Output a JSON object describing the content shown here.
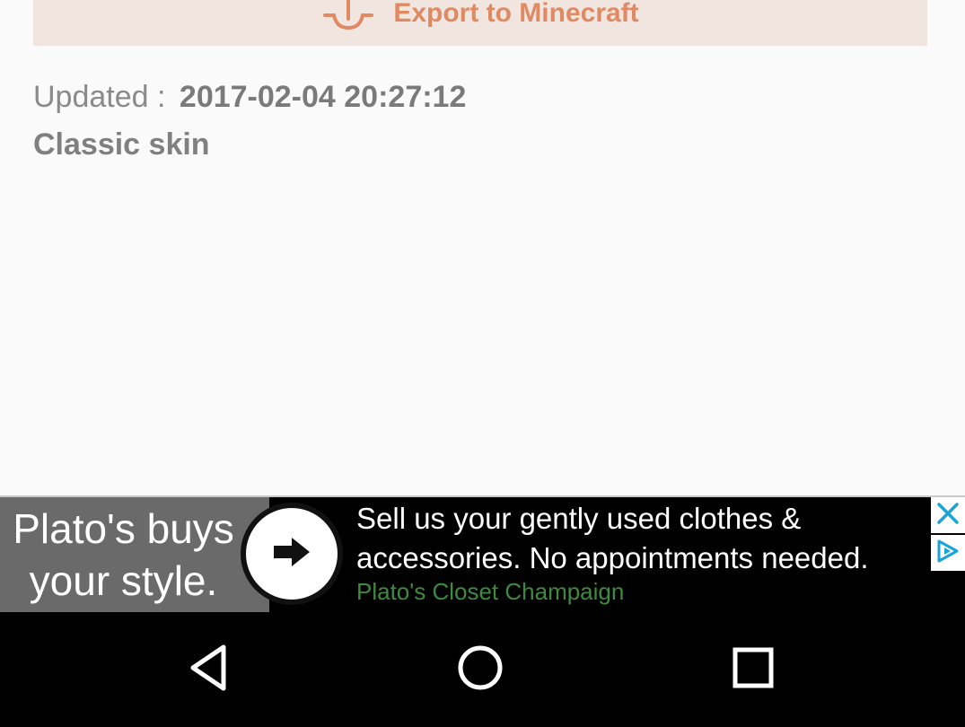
{
  "export_button": {
    "label": "Export to Minecraft",
    "icon": "export-upload-icon",
    "color": "#e08a64",
    "background": "#f1e5e0"
  },
  "details": {
    "updated_label": "Updated :",
    "updated_value": "2017-02-04 20:27:12",
    "skin_type": "Classic skin"
  },
  "ad": {
    "headline_line1": "Plato's buys",
    "headline_line2": "your style.",
    "body": "Sell us your gently used clothes & accessories. No appointments needed.",
    "advertiser": "Plato's Closet Champaign",
    "advertiser_color": "#3f8a3f",
    "arrow_icon": "arrow-right-icon",
    "close_icon": "close-icon",
    "adchoices_icon": "adchoices-icon"
  },
  "navbar": {
    "back_icon": "back-triangle-icon",
    "home_icon": "home-circle-icon",
    "recents_icon": "recents-square-icon"
  }
}
